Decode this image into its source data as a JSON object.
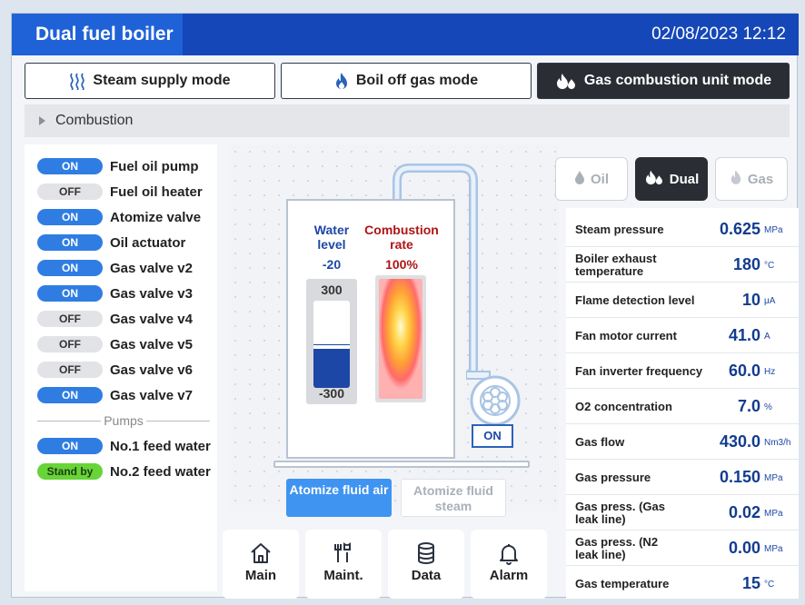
{
  "header": {
    "title": "Dual fuel boiler",
    "datetime": "02/08/2023 12:12"
  },
  "tabs": [
    {
      "label": "Steam supply mode",
      "icon": "steam-icon"
    },
    {
      "label": "Boil off gas mode",
      "icon": "flame-icon"
    },
    {
      "label": "Gas combustion unit mode",
      "icon": "double-flame-icon",
      "active": true
    }
  ],
  "section": {
    "label": "Combustion"
  },
  "devices": [
    {
      "state": "ON",
      "label": "Fuel oil pump"
    },
    {
      "state": "OFF",
      "label": "Fuel oil heater"
    },
    {
      "state": "ON",
      "label": "Atomize valve"
    },
    {
      "state": "ON",
      "label": "Oil actuator"
    },
    {
      "state": "ON",
      "label": "Gas valve v2"
    },
    {
      "state": "ON",
      "label": "Gas valve v3"
    },
    {
      "state": "OFF",
      "label": "Gas valve v4"
    },
    {
      "state": "OFF",
      "label": "Gas valve v5"
    },
    {
      "state": "OFF",
      "label": "Gas valve v6"
    },
    {
      "state": "ON",
      "label": "Gas valve v7"
    }
  ],
  "pumps": {
    "header": "Pumps",
    "items": [
      {
        "state": "ON",
        "label": "No.1 feed water"
      },
      {
        "state": "Stand by",
        "label": "No.2 feed water"
      }
    ]
  },
  "boiler": {
    "water_level_label": "Water level",
    "water_level_value": "-20",
    "gauge_max": "300",
    "gauge_min": "-300",
    "water_fill_fraction": 0.45,
    "combustion_rate_label": "Combustion rate",
    "combustion_rate_value": "100%",
    "fan_state": "ON"
  },
  "atomize": {
    "air": "Atomize fluid air",
    "steam": "Atomize fluid steam",
    "selected": "air"
  },
  "nav": [
    {
      "label": "Main",
      "icon": "home-icon"
    },
    {
      "label": "Maint.",
      "icon": "tools-icon"
    },
    {
      "label": "Data",
      "icon": "database-icon"
    },
    {
      "label": "Alarm",
      "icon": "bell-icon"
    }
  ],
  "fuel_modes": [
    {
      "label": "Oil",
      "active": false
    },
    {
      "label": "Dual",
      "active": true
    },
    {
      "label": "Gas",
      "active": false
    }
  ],
  "measurements": [
    {
      "label": "Steam pressure",
      "value": "0.625",
      "unit": "MPa"
    },
    {
      "label": "Boiler exhaust temperature",
      "value": "180",
      "unit": "°C"
    },
    {
      "label": "Flame detection level",
      "value": "10",
      "unit": "μA"
    },
    {
      "label": "Fan motor current",
      "value": "41.0",
      "unit": "A"
    },
    {
      "label": "Fan inverter frequency",
      "value": "60.0",
      "unit": "Hz"
    },
    {
      "label": "O2 concentration",
      "value": "7.0",
      "unit": "%"
    },
    {
      "label": "Gas flow",
      "value": "430.0",
      "unit": "Nm3/h"
    },
    {
      "label": "Gas pressure",
      "value": "0.150",
      "unit": "MPa"
    },
    {
      "label": "Gas press. (Gas leak line)",
      "value": "0.02",
      "unit": "MPa"
    },
    {
      "label": "Gas press. (N2 leak line)",
      "value": "0.00",
      "unit": "MPa"
    },
    {
      "label": "Gas temperature",
      "value": "15",
      "unit": "°C"
    }
  ],
  "colors": {
    "primary": "#1547b8",
    "on": "#2f7de2",
    "standby": "#67d438",
    "value": "#123c8f"
  }
}
